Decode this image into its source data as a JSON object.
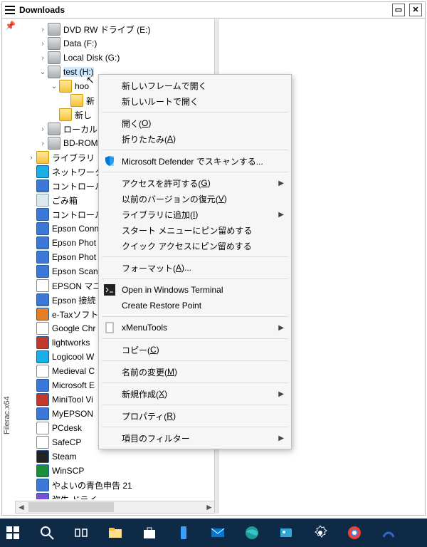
{
  "title": "Downloads",
  "sidebar_text": "Filerac.x64",
  "tree": [
    {
      "indent": 2,
      "exp": ">",
      "icon": "disk",
      "label": "DVD RW ドライブ (E:)"
    },
    {
      "indent": 2,
      "exp": ">",
      "icon": "disk",
      "label": "Data (F:)"
    },
    {
      "indent": 2,
      "exp": ">",
      "icon": "disk",
      "label": "Local Disk (G:)"
    },
    {
      "indent": 2,
      "exp": "v",
      "icon": "disk",
      "label": "test (H:)",
      "selected": true
    },
    {
      "indent": 3,
      "exp": "v",
      "icon": "folder",
      "label": "hoo"
    },
    {
      "indent": 4,
      "exp": "",
      "icon": "folder",
      "label": "新"
    },
    {
      "indent": 3,
      "exp": "",
      "icon": "folder",
      "label": "新し"
    },
    {
      "indent": 2,
      "exp": ">",
      "icon": "disk",
      "label": "ローカル"
    },
    {
      "indent": 2,
      "exp": ">",
      "icon": "disk",
      "label": "BD-ROM"
    },
    {
      "indent": 1,
      "exp": ">",
      "icon": "folder",
      "label": "ライブラリ"
    },
    {
      "indent": 1,
      "exp": "",
      "icon": "app lb",
      "label": "ネットワーク"
    },
    {
      "indent": 1,
      "exp": "",
      "icon": "app",
      "label": "コントロール パ"
    },
    {
      "indent": 1,
      "exp": "",
      "icon": "bin",
      "label": "ごみ箱"
    },
    {
      "indent": 1,
      "exp": "",
      "icon": "app",
      "label": "コントロール パ"
    },
    {
      "indent": 1,
      "exp": "",
      "icon": "app",
      "label": "Epson Conn"
    },
    {
      "indent": 1,
      "exp": "",
      "icon": "app",
      "label": "Epson Phot"
    },
    {
      "indent": 1,
      "exp": "",
      "icon": "app",
      "label": "Epson Phot"
    },
    {
      "indent": 1,
      "exp": "",
      "icon": "app",
      "label": "Epson Scan"
    },
    {
      "indent": 1,
      "exp": "",
      "icon": "app w",
      "label": "EPSON マニュ"
    },
    {
      "indent": 1,
      "exp": "",
      "icon": "app",
      "label": "Epson 接続"
    },
    {
      "indent": 1,
      "exp": "",
      "icon": "app o",
      "label": "e-Taxソフト"
    },
    {
      "indent": 1,
      "exp": "",
      "icon": "app w",
      "label": "Google Chr"
    },
    {
      "indent": 1,
      "exp": "",
      "icon": "app r",
      "label": "lightworks "
    },
    {
      "indent": 1,
      "exp": "",
      "icon": "app lb",
      "label": "Logicool W"
    },
    {
      "indent": 1,
      "exp": "",
      "icon": "app w",
      "label": "Medieval C"
    },
    {
      "indent": 1,
      "exp": "",
      "icon": "app",
      "label": "Microsoft E"
    },
    {
      "indent": 1,
      "exp": "",
      "icon": "app r",
      "label": "MiniTool Vi"
    },
    {
      "indent": 1,
      "exp": "",
      "icon": "app",
      "label": "MyEPSON "
    },
    {
      "indent": 1,
      "exp": "",
      "icon": "app w",
      "label": "PCdesk"
    },
    {
      "indent": 1,
      "exp": "",
      "icon": "app w",
      "label": "SafeCP"
    },
    {
      "indent": 1,
      "exp": "",
      "icon": "app k",
      "label": "Steam"
    },
    {
      "indent": 1,
      "exp": "",
      "icon": "app g",
      "label": "WinSCP"
    },
    {
      "indent": 1,
      "exp": "",
      "icon": "app",
      "label": "やよいの青色申告 21"
    },
    {
      "indent": 1,
      "exp": "",
      "icon": "app p",
      "label": "弥生 ドライ"
    }
  ],
  "context_menu": [
    {
      "type": "item",
      "label": "新しいフレームで開く"
    },
    {
      "type": "item",
      "label": "新しいルートで開く"
    },
    {
      "type": "sep"
    },
    {
      "type": "item",
      "label": "開く(<u>O</u>)"
    },
    {
      "type": "item",
      "label": "折りたたみ(<u>A</u>)"
    },
    {
      "type": "sep"
    },
    {
      "type": "item",
      "label": "Microsoft Defender でスキャンする...",
      "icon": "shield"
    },
    {
      "type": "sep"
    },
    {
      "type": "item",
      "label": "アクセスを許可する(<u>G</u>)",
      "sub": true
    },
    {
      "type": "item",
      "label": "以前のバージョンの復元(<u>V</u>)"
    },
    {
      "type": "item",
      "label": "ライブラリに追加(<u>I</u>)",
      "sub": true
    },
    {
      "type": "item",
      "label": "スタート メニューにピン留めする"
    },
    {
      "type": "item",
      "label": "クイック アクセスにピン留めする"
    },
    {
      "type": "sep"
    },
    {
      "type": "item",
      "label": "フォーマット(<u>A</u>)..."
    },
    {
      "type": "sep"
    },
    {
      "type": "item",
      "label": "Open in Windows Terminal",
      "icon": "terminal"
    },
    {
      "type": "item",
      "label": "Create Restore Point"
    },
    {
      "type": "sep"
    },
    {
      "type": "item",
      "label": "xMenuTools",
      "sub": true,
      "icon": "doc"
    },
    {
      "type": "sep"
    },
    {
      "type": "item",
      "label": "コピー(<u>C</u>)"
    },
    {
      "type": "sep"
    },
    {
      "type": "item",
      "label": "名前の変更(<u>M</u>)"
    },
    {
      "type": "sep"
    },
    {
      "type": "item",
      "label": "新規作成(<u>X</u>)",
      "sub": true
    },
    {
      "type": "sep"
    },
    {
      "type": "item",
      "label": "プロパティ(<u>R</u>)"
    },
    {
      "type": "sep"
    },
    {
      "type": "item",
      "label": "項目のフィルター",
      "sub": true
    }
  ],
  "taskbar": {
    "items": [
      "start",
      "search",
      "taskview",
      "explorer",
      "store",
      "phone",
      "mail",
      "edge",
      "photos",
      "settings",
      "chrome",
      "custom"
    ]
  }
}
